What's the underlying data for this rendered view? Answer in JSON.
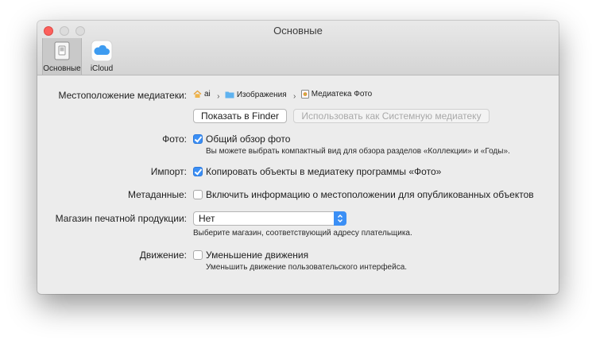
{
  "window": {
    "title": "Основные"
  },
  "tabs": [
    {
      "label": "Основные",
      "icon": "switch-icon"
    },
    {
      "label": "iCloud",
      "icon": "icloud-icon"
    }
  ],
  "library": {
    "label": "Местоположение медиатеки:",
    "path": [
      {
        "text": "ai",
        "icon": "home-icon"
      },
      {
        "text": "Изображения",
        "icon": "folder-icon"
      },
      {
        "text": "Медиатека Фото",
        "icon": "photos-library-icon"
      }
    ],
    "show_in_finder": "Показать в Finder",
    "use_as_system": "Использовать как Системную медиатеку"
  },
  "photos": {
    "label": "Фото:",
    "checkbox": "Общий обзор фото",
    "checked": true,
    "note": "Вы можете выбрать компактный вид для обзора разделов «Коллекции» и «Годы»."
  },
  "import": {
    "label": "Импорт:",
    "checkbox": "Копировать объекты в медиатеку программы «Фото»",
    "checked": true
  },
  "metadata": {
    "label": "Метаданные:",
    "checkbox": "Включить информацию о местоположении для опубликованных объектов",
    "checked": false
  },
  "print_store": {
    "label": "Магазин печатной продукции:",
    "value": "Нет",
    "note": "Выберите магазин, соответствующий адресу плательщика."
  },
  "motion": {
    "label": "Движение:",
    "checkbox": "Уменьшение движения",
    "checked": false,
    "note": "Уменьшить движение пользовательского интерфейса."
  },
  "colors": {
    "accent": "#3b8ff5",
    "close": "#fc605c"
  }
}
